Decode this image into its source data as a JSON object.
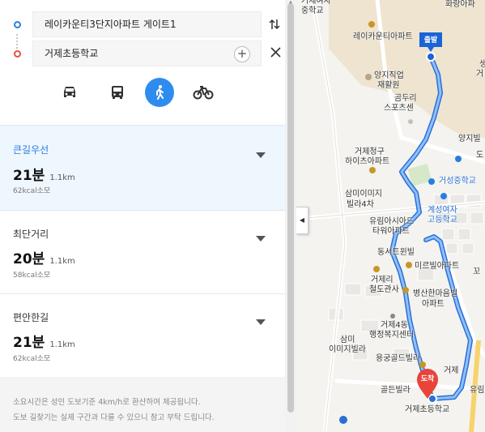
{
  "route": {
    "origin": "레이카운티3단지아파트 게이트1",
    "destination": "거제초등학교",
    "add_label": "+",
    "swap_icon": "swap-vertical-icon",
    "close_icon": "close-icon"
  },
  "modes": [
    {
      "name": "car",
      "icon": "car-icon",
      "active": false
    },
    {
      "name": "transit",
      "icon": "bus-icon",
      "active": false
    },
    {
      "name": "walk",
      "icon": "walking-icon",
      "active": true
    },
    {
      "name": "bike",
      "icon": "bicycle-icon",
      "active": false
    }
  ],
  "routes": [
    {
      "name": "큰길우선",
      "time": "21분",
      "distance": "1.1km",
      "kcal": "62kcal소모",
      "selected": true
    },
    {
      "name": "최단거리",
      "time": "20분",
      "distance": "1.1km",
      "kcal": "58kcal소모",
      "selected": false
    },
    {
      "name": "편안한길",
      "time": "21분",
      "distance": "1.1km",
      "kcal": "62kcal소모",
      "selected": false
    }
  ],
  "footnote": {
    "line1": "소요시간은 성인 도보기준 4km/h로 환산하여 제공됩니다.",
    "line2": "도보 길찾기는 실제 구간과 다를 수 있으니 참고 부탁 드립니다."
  },
  "map": {
    "start_marker": "출발",
    "end_marker": "도착",
    "labels": {
      "l01": "거제여자",
      "l02": "중학교",
      "l03": "화랑아파",
      "l04": "레이카운티아파트",
      "l05": "양지직업",
      "l06": "재활원",
      "l07": "곰두리",
      "l08": "스포츠센",
      "l09": "양지빌",
      "l10": "거제청구",
      "l11": "하이츠아파트",
      "l12": "거성중학교",
      "l13": "삼미이미지",
      "l14": "빌라4차",
      "l15": "계성여자",
      "l16": "고등학교",
      "l17": "유림아시아드",
      "l18": "타워아파트",
      "l19": "동서트윈빌",
      "l20": "미르빌아파트",
      "l21": "거제리",
      "l22": "철도관사",
      "l23": "병산한마음빌",
      "l24": "아파트",
      "l25": "거제4동",
      "l26": "행정복지센터",
      "l27": "삼미",
      "l28": "이미지빌라",
      "l29": "용궁골드빌라",
      "l30": "골든빌라",
      "l31": "거제초등학교",
      "l32": "유림",
      "l33": "거제",
      "l34": "생",
      "l35": "거",
      "l36": "도",
      "l37": "꼬"
    },
    "colors": {
      "route": "#4a90f0",
      "route_edge": "#2a6fd6",
      "start_pin": "#1a64d6",
      "end_pin": "#e8443a",
      "mode_active": "#2f8cef"
    }
  }
}
